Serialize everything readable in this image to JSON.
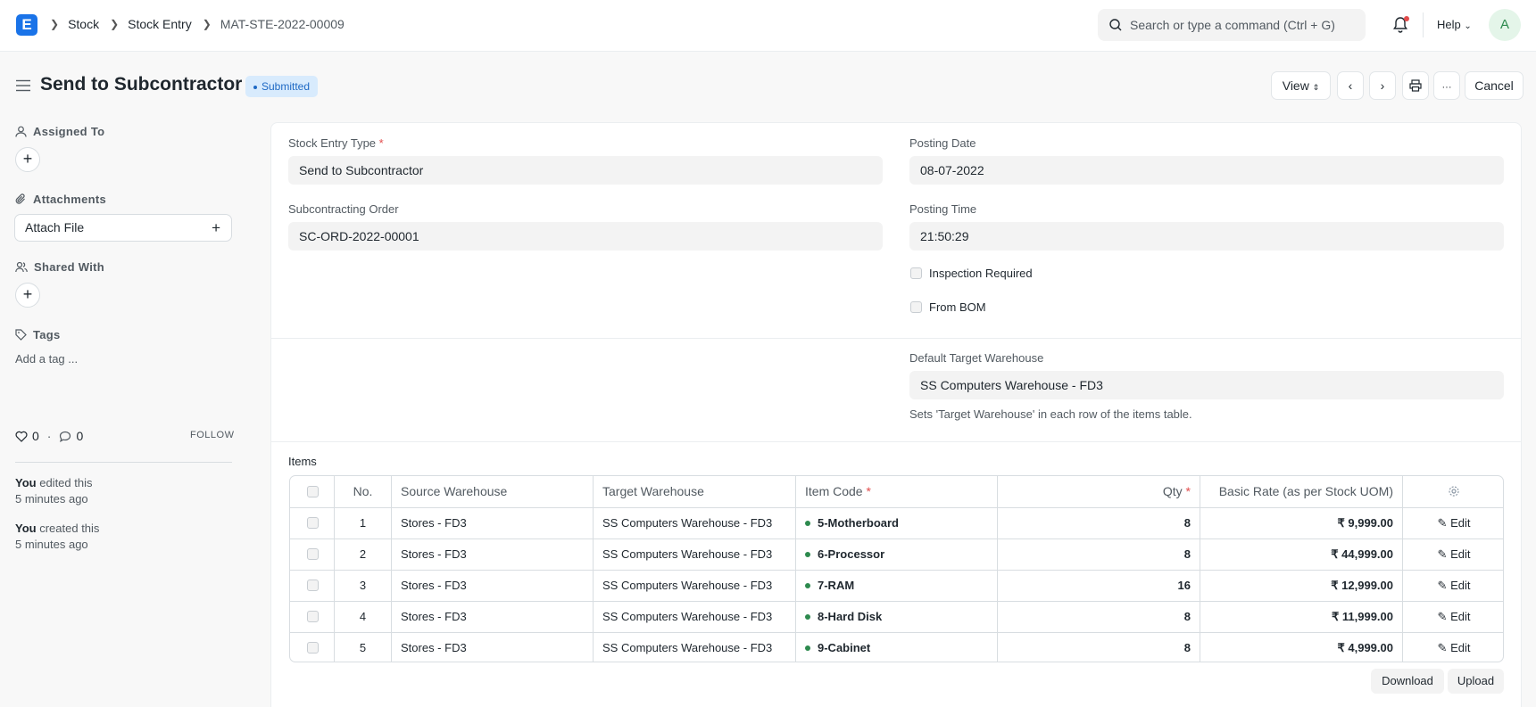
{
  "navbar": {
    "logo": "E",
    "breadcrumbs": [
      "Stock",
      "Stock Entry",
      "MAT-STE-2022-00009"
    ],
    "search_placeholder": "Search or type a command (Ctrl + G)",
    "help_label": "Help",
    "avatar_initial": "A"
  },
  "page": {
    "title": "Send to Subcontractor",
    "status": "Submitted",
    "view_label": "View",
    "cancel_label": "Cancel",
    "more_label": "···"
  },
  "sidebar": {
    "assigned_to": "Assigned To",
    "attachments": "Attachments",
    "attach_file": "Attach File",
    "shared_with": "Shared With",
    "tags": "Tags",
    "add_tag": "Add a tag ...",
    "likes": "0",
    "comments": "0",
    "separator": "·",
    "follow": "FOLLOW",
    "activity": [
      {
        "who": "You",
        "action": "edited this",
        "when": "5 minutes ago"
      },
      {
        "who": "You",
        "action": "created this",
        "when": "5 minutes ago"
      }
    ]
  },
  "form": {
    "stock_entry_type_label": "Stock Entry Type",
    "stock_entry_type": "Send to Subcontractor",
    "subcontracting_order_label": "Subcontracting Order",
    "subcontracting_order": "SC-ORD-2022-00001",
    "posting_date_label": "Posting Date",
    "posting_date": "08-07-2022",
    "posting_time_label": "Posting Time",
    "posting_time": "21:50:29",
    "inspection_required": "Inspection Required",
    "from_bom": "From BOM",
    "default_target_warehouse_label": "Default Target Warehouse",
    "default_target_warehouse": "SS Computers Warehouse - FD3",
    "default_target_warehouse_desc": "Sets 'Target Warehouse' in each row of the items table."
  },
  "items": {
    "title": "Items",
    "headers": {
      "no": "No.",
      "source": "Source Warehouse",
      "target": "Target Warehouse",
      "item_code": "Item Code",
      "qty": "Qty",
      "rate": "Basic Rate (as per Stock UOM)"
    },
    "rows": [
      {
        "no": "1",
        "source": "Stores - FD3",
        "target": "SS Computers Warehouse - FD3",
        "item_code": "5-Motherboard",
        "qty": "8",
        "rate": "₹ 9,999.00",
        "edit": "Edit"
      },
      {
        "no": "2",
        "source": "Stores - FD3",
        "target": "SS Computers Warehouse - FD3",
        "item_code": "6-Processor",
        "qty": "8",
        "rate": "₹ 44,999.00",
        "edit": "Edit"
      },
      {
        "no": "3",
        "source": "Stores - FD3",
        "target": "SS Computers Warehouse - FD3",
        "item_code": "7-RAM",
        "qty": "16",
        "rate": "₹ 12,999.00",
        "edit": "Edit"
      },
      {
        "no": "4",
        "source": "Stores - FD3",
        "target": "SS Computers Warehouse - FD3",
        "item_code": "8-Hard Disk",
        "qty": "8",
        "rate": "₹ 11,999.00",
        "edit": "Edit"
      },
      {
        "no": "5",
        "source": "Stores - FD3",
        "target": "SS Computers Warehouse - FD3",
        "item_code": "9-Cabinet",
        "qty": "8",
        "rate": "₹ 4,999.00",
        "edit": "Edit"
      }
    ],
    "download_label": "Download",
    "upload_label": "Upload"
  },
  "colors": {
    "accent": "#1a73e8",
    "status_badge_bg": "#d8ebfd",
    "status_badge_text": "#1e69c4",
    "item_dot": "#2d8a4e",
    "required": "#e24c4c"
  }
}
